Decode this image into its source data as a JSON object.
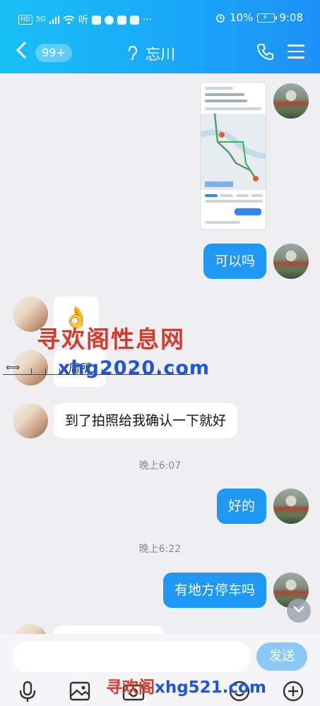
{
  "status_bar": {
    "network_chip": "HD",
    "signal_text": "5G",
    "app_label": "听",
    "battery_percent": "10%",
    "time": "9:08"
  },
  "header": {
    "back_icon": "chevron-left-icon",
    "unread_badge": "99+",
    "contact_name": "忘川",
    "mode_icon": "ear-icon",
    "call_icon": "phone-icon",
    "menu_icon": "hamburger-menu-icon"
  },
  "messages": [
    {
      "side": "me",
      "type": "image",
      "content": "map-screenshot"
    },
    {
      "side": "me",
      "type": "text",
      "content": "可以吗"
    },
    {
      "side": "other",
      "type": "sticker",
      "content": "👌"
    },
    {
      "side": "other",
      "type": "text",
      "content": "到了拍照给我确认一下就好"
    },
    {
      "side": "system",
      "type": "time",
      "content": "晚上6:07"
    },
    {
      "side": "me",
      "type": "text",
      "content": "好的"
    },
    {
      "side": "system",
      "type": "time",
      "content": "晚上6:22"
    },
    {
      "side": "me",
      "type": "text",
      "content": "有地方停车吗"
    }
  ],
  "partial_sticker_text": "周所",
  "watermarks": {
    "line1": "寻欢阁性息网",
    "line2": "xhg2020.com",
    "line3_red": "寻欢阁",
    "line3_blue": "xhg521.com"
  },
  "composer": {
    "input_value": "",
    "send_label": "发送"
  },
  "toolbar_icons": [
    "microphone-icon",
    "image-icon",
    "camera-icon",
    "emoji-icon",
    "add-icon"
  ],
  "colors": {
    "header_start": "#19c0f5",
    "header_end": "#1d90f7",
    "my_bubble": "#1f98f5",
    "send_button": "#8cc8f4"
  }
}
